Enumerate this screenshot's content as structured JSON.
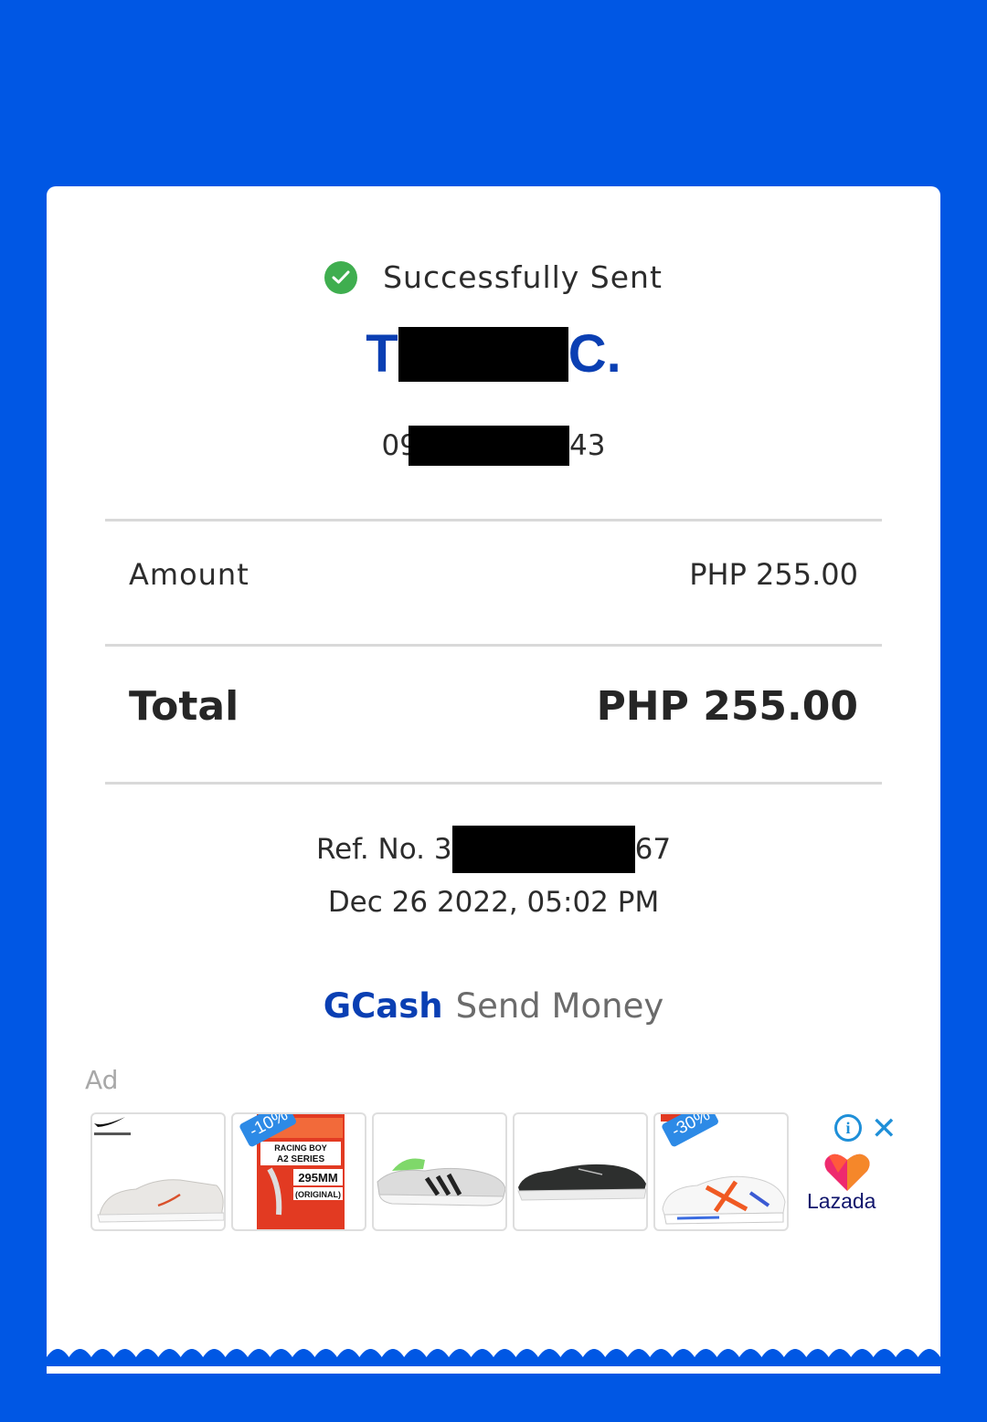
{
  "status": {
    "text": "Successfully Sent",
    "icon": "check-circle-icon"
  },
  "recipient": {
    "name_start": "T",
    "name_end": "C.",
    "phone_start": "09",
    "phone_end": "43"
  },
  "amount": {
    "label": "Amount",
    "value": "PHP 255.00"
  },
  "total": {
    "label": "Total",
    "value": "PHP 255.00"
  },
  "reference": {
    "prefix": "Ref. No. 3",
    "suffix": "67"
  },
  "date": "Dec 26 2022, 05:02 PM",
  "brand": {
    "name": "GCash",
    "service": "Send Money"
  },
  "ad": {
    "label": "Ad",
    "tiles": [
      {
        "name": "sneaker-white-nike",
        "tag": ""
      },
      {
        "name": "racing-boy-product",
        "tag": "-10%"
      },
      {
        "name": "sneaker-grey-running",
        "tag": ""
      },
      {
        "name": "sneaker-black",
        "tag": ""
      },
      {
        "name": "sneaker-white-orange",
        "tag": "-30%"
      }
    ],
    "advertiser": "Lazada"
  },
  "colors": {
    "background": "#0057e4",
    "brand_blue": "#0a3fb3",
    "success_green": "#3fae4f"
  }
}
